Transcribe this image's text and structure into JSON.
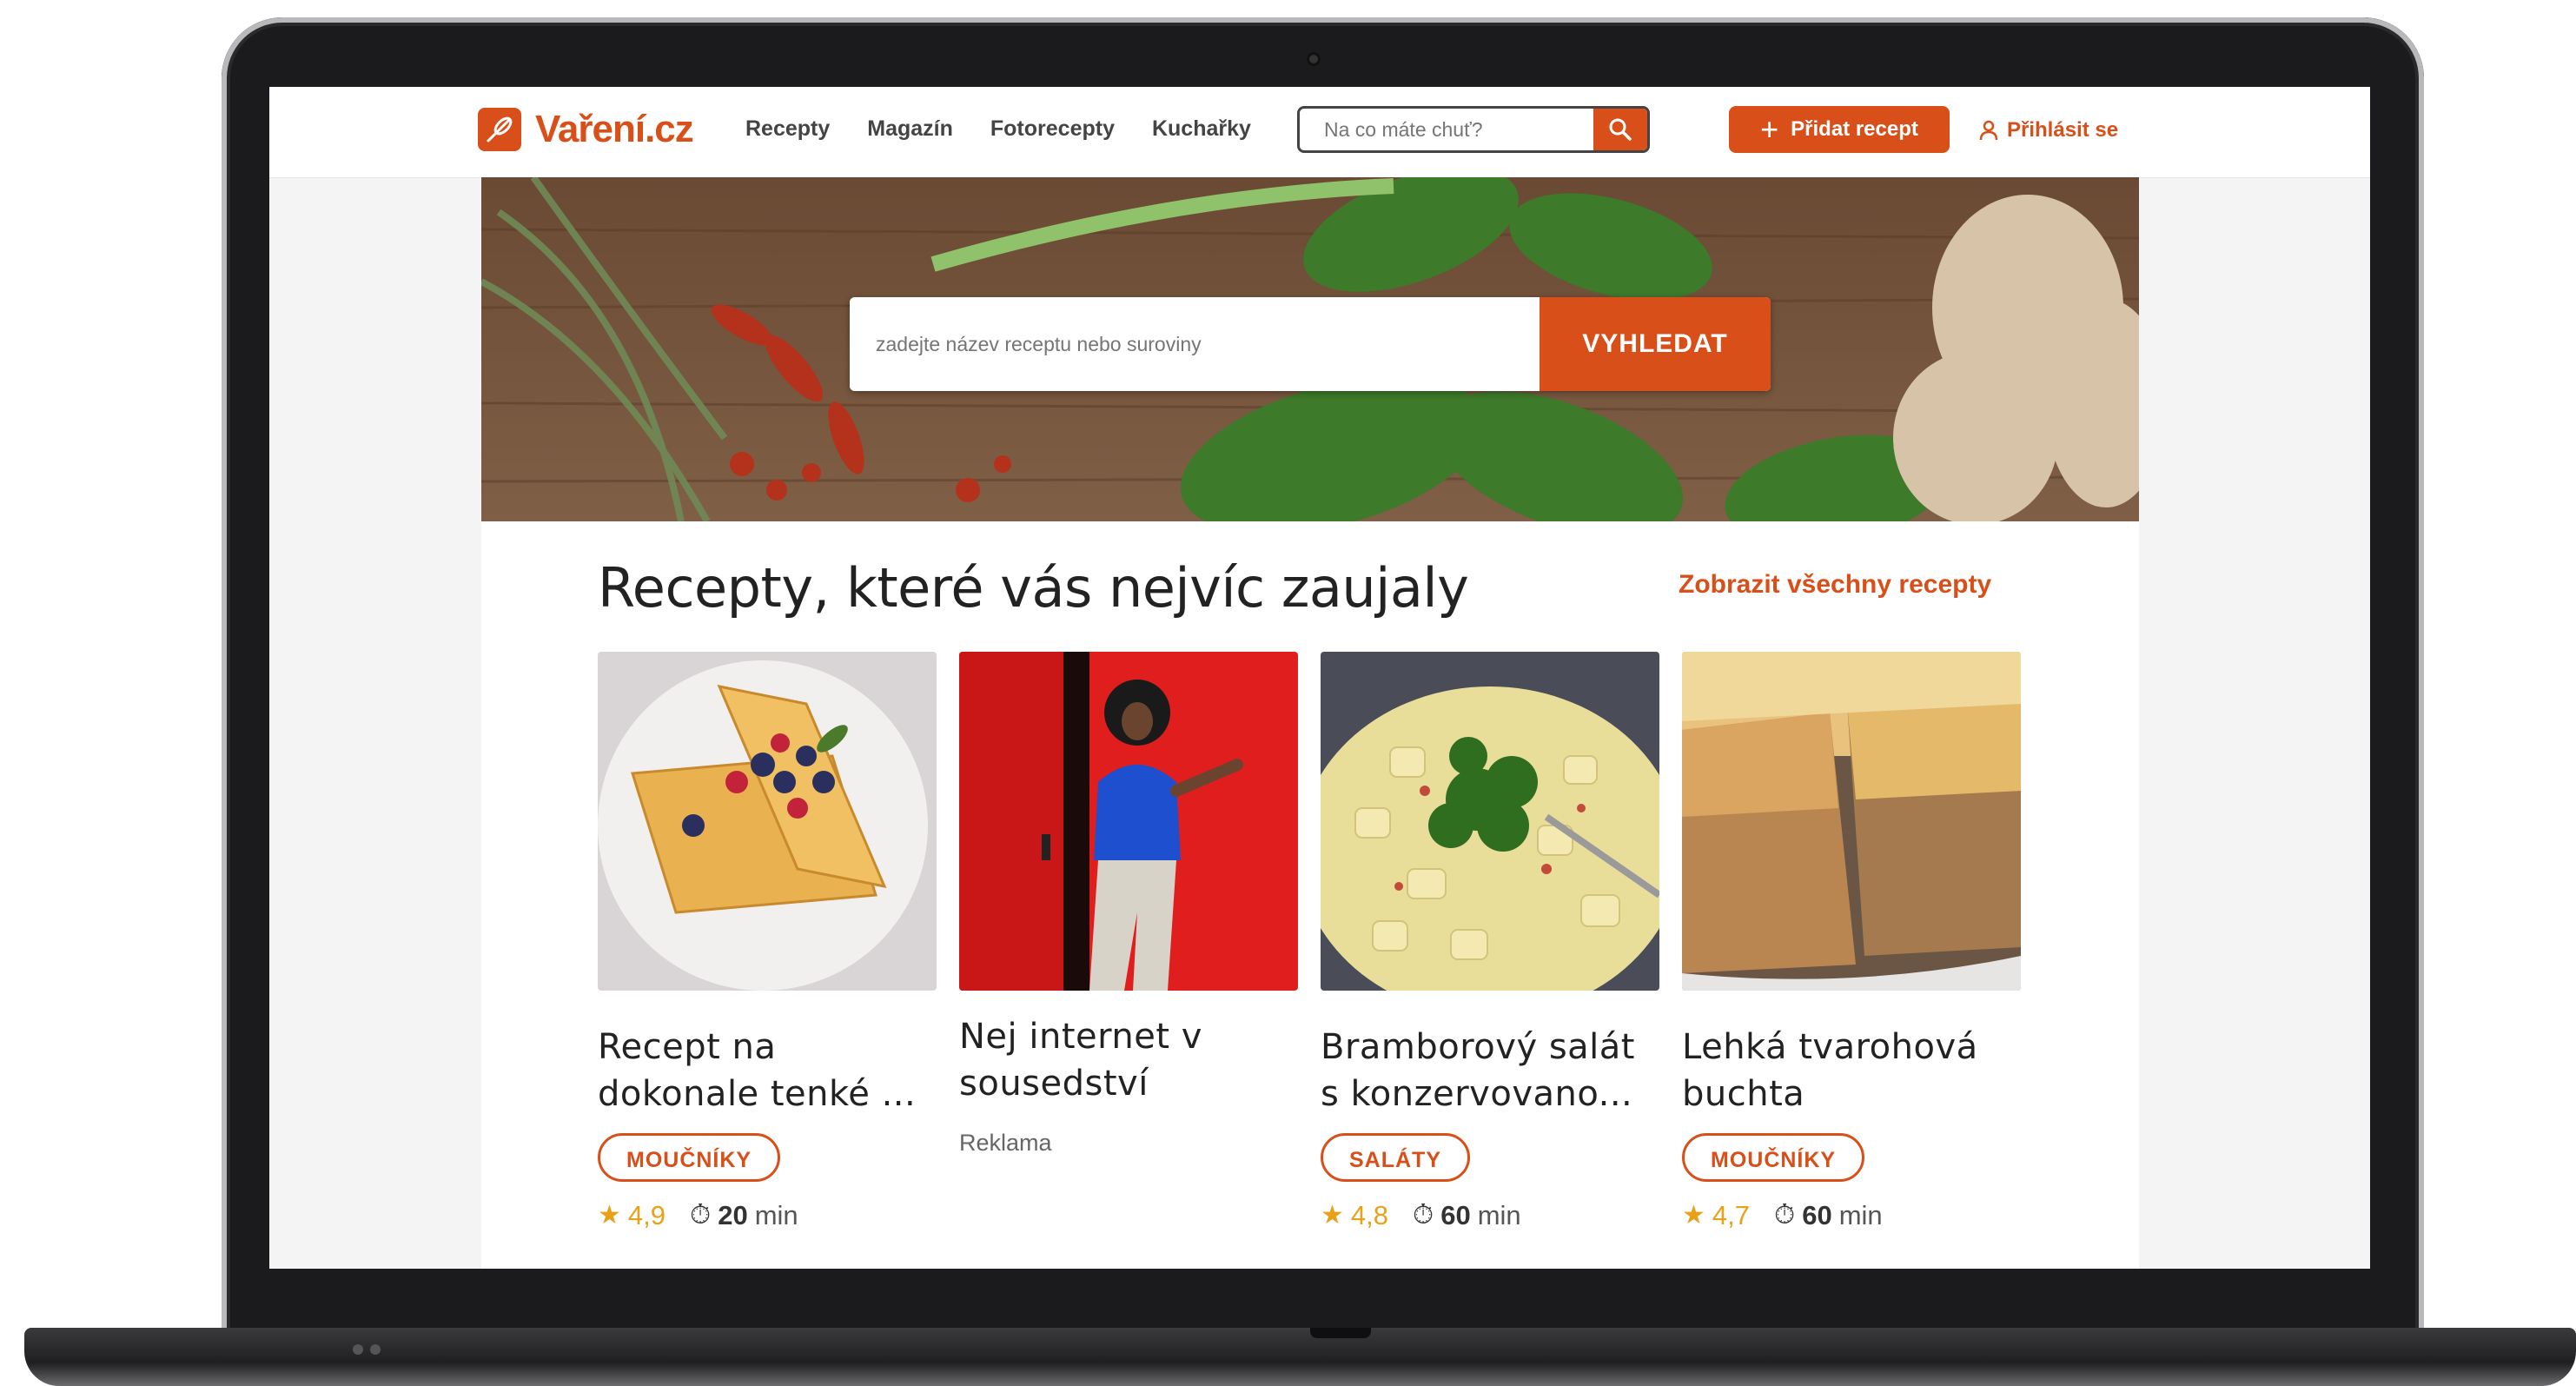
{
  "header": {
    "logo": "Vaření.cz",
    "nav": [
      "Recepty",
      "Magazín",
      "Fotorecepty",
      "Kuchařky"
    ],
    "search_placeholder": "Na co máte chuť?",
    "add_recipe": "Přidat recept",
    "login": "Přihlásit se"
  },
  "hero": {
    "search_placeholder": "zadejte název receptu nebo suroviny",
    "search_button": "VYHLEDAT"
  },
  "section": {
    "title": "Recepty, které vás nejvíc zaujaly",
    "link": "Zobrazit všechny recepty",
    "cards": [
      {
        "title": "Recept na dokonale tenké ...",
        "tag": "MOUČNÍKY",
        "rating": "4,9",
        "time": "20",
        "unit": "min"
      },
      {
        "title": "Nej internet v sousedství",
        "ad": "Reklama"
      },
      {
        "title": "Bramborový salát s konzervovano...",
        "tag": "SALÁTY",
        "rating": "4,8",
        "time": "60",
        "unit": "min"
      },
      {
        "title": "Lehká tvarohová buchta",
        "tag": "MOUČNÍKY",
        "rating": "4,7",
        "time": "60",
        "unit": "min"
      }
    ]
  },
  "colors": {
    "accent": "#d94f19",
    "star": "#e8a21a"
  }
}
